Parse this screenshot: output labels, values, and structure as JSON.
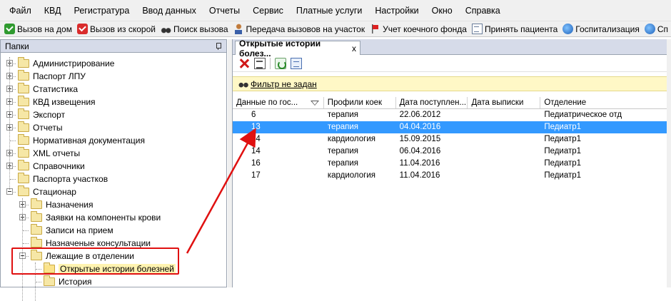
{
  "menu": [
    "Файл",
    "КВД",
    "Регистратура",
    "Ввод данных",
    "Отчеты",
    "Сервис",
    "Платные услуги",
    "Настройки",
    "Окно",
    "Справка"
  ],
  "toolbar": [
    {
      "label": "Вызов на дом",
      "icon": "green-check-icon"
    },
    {
      "label": "Вызов из скорой",
      "icon": "red-check-icon"
    },
    {
      "label": "Поиск вызова",
      "icon": "binoculars-icon"
    },
    {
      "label": "Передача вызовов на участок",
      "icon": "person-icon"
    },
    {
      "label": "Учет коечного фонда",
      "icon": "flag-icon"
    },
    {
      "label": "Принять пациента",
      "icon": "document-icon"
    },
    {
      "label": "Госпитализация",
      "icon": "globe-icon"
    },
    {
      "label": "Сп",
      "icon": "globe-icon"
    }
  ],
  "left_panel": {
    "title": "Папки",
    "tree": [
      "Администрирование",
      "Паспорт ЛПУ",
      "Статистика",
      "КВД извещения",
      "Экспорт",
      "Отчеты",
      "Нормативная документация",
      "XML отчеты",
      "Справочники",
      "Паспорта участков",
      "Стационар",
      "Назначения",
      "Заявки на компоненты крови",
      "Записи на прием",
      "Назначеные консультации",
      "Лежащие в отделении",
      "Открытые истории болезней",
      "История"
    ]
  },
  "right_panel": {
    "tab_title": "Открытые истории болез...",
    "tab_close": "x",
    "filter_text": "Фильтр не задан",
    "columns": [
      "Данные по гос...",
      "Профили коек",
      "Дата поступлен...",
      "Дата выписки",
      "Отделение"
    ],
    "rows": [
      [
        "6",
        "терапия",
        "22.06.2012",
        "",
        "Педиатрическое отд"
      ],
      [
        "13",
        "терапия",
        "04.04.2016",
        "",
        "Педиатр1"
      ],
      [
        "14",
        "кардиология",
        "15.09.2015",
        "",
        "Педиатр1"
      ],
      [
        "14",
        "терапия",
        "06.04.2016",
        "",
        "Педиатр1"
      ],
      [
        "16",
        "терапия",
        "11.04.2016",
        "",
        "Педиатр1"
      ],
      [
        "17",
        "кардиология",
        "11.04.2016",
        "",
        "Педиатр1"
      ]
    ],
    "selected_row": 1
  },
  "colors": {
    "selection": "#3399ff",
    "annotation": "#e01010",
    "filter_bg": "#fff8c6",
    "panel_header": "#d6dbe9"
  }
}
